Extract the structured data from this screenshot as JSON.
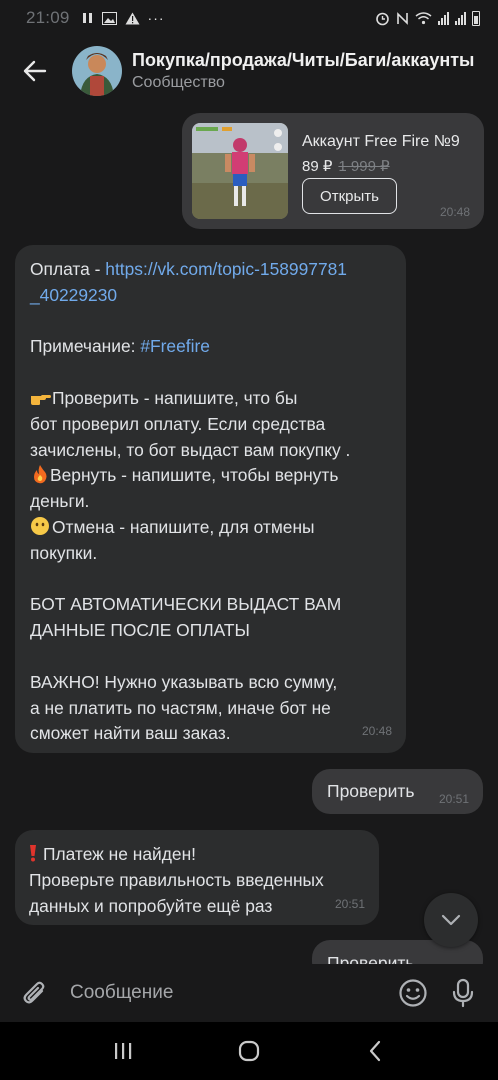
{
  "status_bar": {
    "time": "21:09",
    "more": "···"
  },
  "header": {
    "title": "Покупка/продажа/Читы/Баги/аккаунты",
    "subtitle": "Сообщество"
  },
  "product_card": {
    "title": "Аккаунт Free Fire №9",
    "price": "89 ₽",
    "old_price": "1 999 ₽",
    "open_label": "Открыть",
    "time": "20:48"
  },
  "bot_message": {
    "payment_prefix": "Оплата - ",
    "payment_link_1": "https://vk.com/topic-158997781",
    "payment_link_2": "_40229230",
    "note_prefix": "Примечание: ",
    "note_tag": "#Freefire",
    "check_1": "Проверить - напишите, что бы",
    "check_2": "бот проверил оплату. Если средства",
    "check_3": "зачислены, то бот выдаст вам покупку .",
    "refund_1": "Вернуть - напишите, чтобы вернуть",
    "refund_2": "деньги.",
    "cancel_1": "Отмена - напишите, для отмены",
    "cancel_2": "покупки.",
    "caps_1": "БОТ АВТОМАТИЧЕСКИ ВЫДАСТ ВАМ",
    "caps_2": "ДАННЫЕ ПОСЛЕ ОПЛАТЫ",
    "important_1": "ВАЖНО! Нужно указывать всю сумму,",
    "important_2": "а не платить по частям, иначе бот не",
    "important_3": "сможет найти ваш заказ.",
    "time": "20:48"
  },
  "outgoing_check": {
    "text": "Проверить",
    "time": "20:51"
  },
  "not_found_message": {
    "line_1": "Платеж не найден!",
    "line_2": "Проверьте правильность введенных",
    "line_3": "данных и попробуйте ещё раз",
    "time": "20:51"
  },
  "outgoing_partial": {
    "text": "Проверить"
  },
  "composer": {
    "placeholder": "Сообщение"
  },
  "colors": {
    "background": "#19191a",
    "bubble_in": "#2c2d2e",
    "bubble_out": "#39393b",
    "link": "#71aaeb",
    "error": "#e0342c"
  }
}
